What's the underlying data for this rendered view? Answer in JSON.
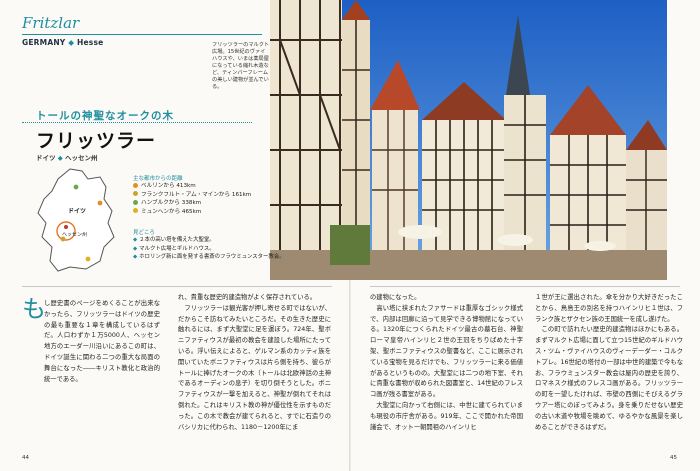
{
  "header": {
    "city": "Fritzlar",
    "country": "GERMANY",
    "region": "Hesse"
  },
  "caption": "フリッツラーのマルクト広場。15世紀のヴァイハウスや、いまは薬局屋になっている縮れ木造など、ティンバーフレームの美しい建物が並んでいる。",
  "subtitle": "トールの神聖なオークの木",
  "title": "フリッツラー",
  "title_sub": {
    "country": "ドイツ",
    "region": "ヘッセン州"
  },
  "map": {
    "label_country": "ドイツ",
    "label_region": "ヘッセン州"
  },
  "access": {
    "heading": "主な都市からの距離",
    "items": [
      {
        "text": "ベルリンから 413km",
        "color": "#e58b2a"
      },
      {
        "text": "フランクフルト・アム・マインから 161km",
        "color": "#d0a12e"
      },
      {
        "text": "ハンブルクから 338km",
        "color": "#6aa84f"
      },
      {
        "text": "ミュンヘンから 465km",
        "color": "#e0b020"
      }
    ]
  },
  "highlights": {
    "heading": "見どころ",
    "items": [
      "２本の高い塔を備えた大聖堂。",
      "マルクト広場とギルドハウス。",
      "ホロリング新に面を発する書斎のフラウミュンスター教会。"
    ]
  },
  "body": {
    "dropcap": "も",
    "col1": "し歴史書のページをめくることが出来なかったら、フリッツラーはドイツの歴史の最も重要な１章を構成しているはずだ。人口わずか１万5000人、ヘッセン地方のエーダー川沿いにあるこの町は、ドイツ誕生に関わる二つの重大な局面の舞台になった――キリスト教化と政治的統一である。",
    "col2": "れ、貴重な歴史的建造物がよく保存されている。\n　フリッツラーは観光客が押し寄せる町ではないが、だからこそ訪ねてみたいところだ。その生きた歴史に触れるには、まず大聖堂に足を運ぼう。724年、聖ボニファティウスが最初の教会を建設した場所にたっている。浮い伝えによると、ゲルマン系のカッティ族を開いていたボニファティウスは片ら側を持ち、彼らがトールに捧げたオークの木（トールは北欧神話の主神であるオーディンの息子）を切り倒そうとした。ボニファティウスが一撃を加えると、神聖が倒れてそれは倒れた。これはキリスト教の神が優位性を示すものだった。この木で教会が建てられると、すでに石造りのバシリカに代わられ、1180－1200年にま",
    "col3": "の建物になった。\n　高い塔に挟まれたファサードは重厚なゴシック様式で、内部は回廊に沿って見学できる博物館になっている。1320年につくられたドイツ最古の墓石台、神聖ローマ皇帝ハインリヒ２世の王冠をちりばめた十字架、聖ボニファティウスの聖書など、ここに展示されている宝物を見るだけでも、フリッツラーに来る価値があるというものの。大聖堂には二つの地下室、それに貴重な書物が収められた図書室と、14世紀のフレスコ画が残る書室がある。\n　大聖堂に向かって右側には、中世に建てられていまも現役の市庁舎がある。919年、ここで開かれた帝国議会で、オットー朝開祖のハインリヒ",
    "col4": "１世が王に選出された。傘を分かり大好きだったことから、鳥島王の別名を持つハインリヒ１世は、フランク族とザクセン族の王国統一を成し遂げた。\n　この町で訪れたい歴史的建造物はほかにもある。まずマルクト広場に面して立つ15世紀のギルドハウス・ツム・ヴァイハウスのヴィーデーダー・コルクトプレ。16世紀の塔付の一部は中世的建築で今もなお、フラウミュンスター教会は屋内の歴史を誇り、ロマネスク様式のフレスコ画がある。フリッツラーの町を一望したければ、市壁の西側にそびえるグラウアー塔にのぼってみよう。身を乗りだせない歴史の古い木道や牧場を眺めて、ゆるやかな風景を楽しめることができるはずだ。"
  },
  "page_numbers": {
    "left": "44",
    "right": "45"
  }
}
